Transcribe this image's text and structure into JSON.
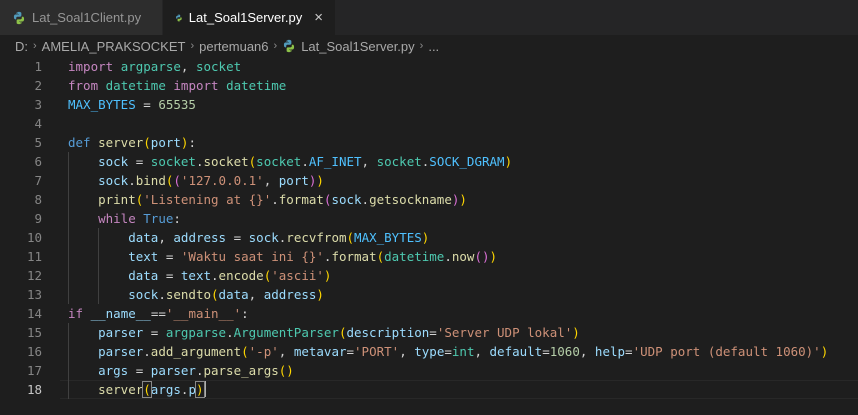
{
  "tabs": [
    {
      "label": "Lat_Soal1Client.py",
      "active": false
    },
    {
      "label": "Lat_Soal1Server.py",
      "active": true,
      "close": "×"
    }
  ],
  "breadcrumb": {
    "items": [
      "D:",
      "AMELIA_PRAKSOCKET",
      "pertemuan6",
      "Lat_Soal1Server.py",
      "..."
    ],
    "separator": "›"
  },
  "editor": {
    "current_line": 18,
    "line_numbers": [
      "1",
      "2",
      "3",
      "4",
      "5",
      "6",
      "7",
      "8",
      "9",
      "10",
      "11",
      "12",
      "13",
      "14",
      "15",
      "16",
      "17",
      "18"
    ],
    "tokens": [
      [
        [
          "kw",
          "import"
        ],
        [
          "op",
          " "
        ],
        [
          "mod",
          "argparse"
        ],
        [
          "op",
          ", "
        ],
        [
          "mod",
          "socket"
        ]
      ],
      [
        [
          "kw",
          "from"
        ],
        [
          "op",
          " "
        ],
        [
          "mod",
          "datetime"
        ],
        [
          "op",
          " "
        ],
        [
          "kw",
          "import"
        ],
        [
          "op",
          " "
        ],
        [
          "mod",
          "datetime"
        ]
      ],
      [
        [
          "cst",
          "MAX_BYTES"
        ],
        [
          "op",
          " = "
        ],
        [
          "num",
          "65535"
        ]
      ],
      [],
      [
        [
          "def",
          "def"
        ],
        [
          "op",
          " "
        ],
        [
          "fn",
          "server"
        ],
        [
          "br1",
          "("
        ],
        [
          "var",
          "port"
        ],
        [
          "br1",
          ")"
        ],
        [
          "op",
          ":"
        ]
      ],
      [
        [
          "op",
          "    "
        ],
        [
          "var",
          "sock"
        ],
        [
          "op",
          " = "
        ],
        [
          "mod",
          "socket"
        ],
        [
          "op",
          "."
        ],
        [
          "fn",
          "socket"
        ],
        [
          "br1",
          "("
        ],
        [
          "mod",
          "socket"
        ],
        [
          "op",
          "."
        ],
        [
          "cst",
          "AF_INET"
        ],
        [
          "op",
          ", "
        ],
        [
          "mod",
          "socket"
        ],
        [
          "op",
          "."
        ],
        [
          "cst",
          "SOCK_DGRAM"
        ],
        [
          "br1",
          ")"
        ]
      ],
      [
        [
          "op",
          "    "
        ],
        [
          "var",
          "sock"
        ],
        [
          "op",
          "."
        ],
        [
          "fn",
          "bind"
        ],
        [
          "br1",
          "("
        ],
        [
          "br2",
          "("
        ],
        [
          "str",
          "'127.0.0.1'"
        ],
        [
          "op",
          ", "
        ],
        [
          "var",
          "port"
        ],
        [
          "br2",
          ")"
        ],
        [
          "br1",
          ")"
        ]
      ],
      [
        [
          "op",
          "    "
        ],
        [
          "fn",
          "print"
        ],
        [
          "br1",
          "("
        ],
        [
          "str",
          "'Listening at {}'"
        ],
        [
          "op",
          "."
        ],
        [
          "fn",
          "format"
        ],
        [
          "br2",
          "("
        ],
        [
          "var",
          "sock"
        ],
        [
          "op",
          "."
        ],
        [
          "fn",
          "getsockname"
        ],
        [
          "br2",
          ")"
        ],
        [
          "br1",
          ")"
        ]
      ],
      [
        [
          "op",
          "    "
        ],
        [
          "kw",
          "while"
        ],
        [
          "op",
          " "
        ],
        [
          "def",
          "True"
        ],
        [
          "op",
          ":"
        ]
      ],
      [
        [
          "op",
          "        "
        ],
        [
          "var",
          "data"
        ],
        [
          "op",
          ", "
        ],
        [
          "var",
          "address"
        ],
        [
          "op",
          " = "
        ],
        [
          "var",
          "sock"
        ],
        [
          "op",
          "."
        ],
        [
          "fn",
          "recvfrom"
        ],
        [
          "br1",
          "("
        ],
        [
          "cst",
          "MAX_BYTES"
        ],
        [
          "br1",
          ")"
        ]
      ],
      [
        [
          "op",
          "        "
        ],
        [
          "var",
          "text"
        ],
        [
          "op",
          " = "
        ],
        [
          "str",
          "'Waktu saat ini {}'"
        ],
        [
          "op",
          "."
        ],
        [
          "fn",
          "format"
        ],
        [
          "br1",
          "("
        ],
        [
          "mod",
          "datetime"
        ],
        [
          "op",
          "."
        ],
        [
          "fn",
          "now"
        ],
        [
          "br2",
          "()"
        ],
        [
          "br1",
          ")"
        ]
      ],
      [
        [
          "op",
          "        "
        ],
        [
          "var",
          "data"
        ],
        [
          "op",
          " = "
        ],
        [
          "var",
          "text"
        ],
        [
          "op",
          "."
        ],
        [
          "fn",
          "encode"
        ],
        [
          "br1",
          "("
        ],
        [
          "str",
          "'ascii'"
        ],
        [
          "br1",
          ")"
        ]
      ],
      [
        [
          "op",
          "        "
        ],
        [
          "var",
          "sock"
        ],
        [
          "op",
          "."
        ],
        [
          "fn",
          "sendto"
        ],
        [
          "br1",
          "("
        ],
        [
          "var",
          "data"
        ],
        [
          "op",
          ", "
        ],
        [
          "var",
          "address"
        ],
        [
          "br1",
          ")"
        ]
      ],
      [
        [
          "kw",
          "if"
        ],
        [
          "op",
          " "
        ],
        [
          "var",
          "__name__"
        ],
        [
          "op",
          "=="
        ],
        [
          "str",
          "'__main__'"
        ],
        [
          "op",
          ":"
        ]
      ],
      [
        [
          "op",
          "    "
        ],
        [
          "var",
          "parser"
        ],
        [
          "op",
          " = "
        ],
        [
          "mod",
          "argparse"
        ],
        [
          "op",
          "."
        ],
        [
          "mod",
          "ArgumentParser"
        ],
        [
          "br1",
          "("
        ],
        [
          "var",
          "description"
        ],
        [
          "op",
          "="
        ],
        [
          "str",
          "'Server UDP lokal'"
        ],
        [
          "br1",
          ")"
        ]
      ],
      [
        [
          "op",
          "    "
        ],
        [
          "var",
          "parser"
        ],
        [
          "op",
          "."
        ],
        [
          "fn",
          "add_argument"
        ],
        [
          "br1",
          "("
        ],
        [
          "str",
          "'-p'"
        ],
        [
          "op",
          ", "
        ],
        [
          "var",
          "metavar"
        ],
        [
          "op",
          "="
        ],
        [
          "str",
          "'PORT'"
        ],
        [
          "op",
          ", "
        ],
        [
          "var",
          "type"
        ],
        [
          "op",
          "="
        ],
        [
          "mod",
          "int"
        ],
        [
          "op",
          ", "
        ],
        [
          "var",
          "default"
        ],
        [
          "op",
          "="
        ],
        [
          "num",
          "1060"
        ],
        [
          "op",
          ", "
        ],
        [
          "var",
          "help"
        ],
        [
          "op",
          "="
        ],
        [
          "str",
          "'UDP port (default 1060)'"
        ],
        [
          "br1",
          ")"
        ]
      ],
      [
        [
          "op",
          "    "
        ],
        [
          "var",
          "args"
        ],
        [
          "op",
          " = "
        ],
        [
          "var",
          "parser"
        ],
        [
          "op",
          "."
        ],
        [
          "fn",
          "parse_args"
        ],
        [
          "br1",
          "()"
        ]
      ],
      [
        [
          "op",
          "    "
        ],
        [
          "fn",
          "server"
        ],
        [
          "br1",
          "("
        ],
        [
          "var",
          "args"
        ],
        [
          "op",
          "."
        ],
        [
          "var",
          "p"
        ],
        [
          "br1",
          ")"
        ]
      ]
    ]
  }
}
